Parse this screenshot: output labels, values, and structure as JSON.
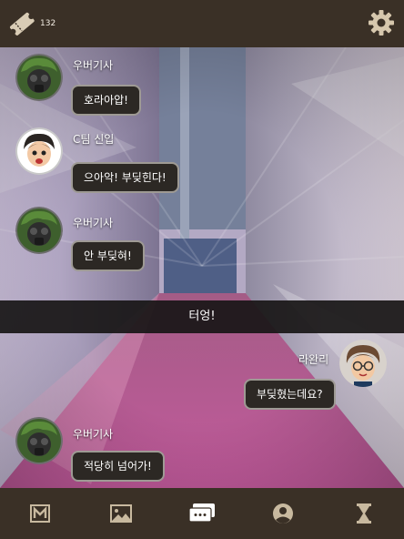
{
  "header": {
    "ticket_count": "132",
    "ticket_icon": "ticket-icon",
    "settings_icon": "gear-icon"
  },
  "chat": {
    "messages": [
      {
        "speaker": "우버기사",
        "text": "호라아압!",
        "side": "left"
      },
      {
        "speaker": "C팀 신입",
        "text": "으아악! 부딪힌다!",
        "side": "left"
      },
      {
        "speaker": "우버기사",
        "text": "안 부딪혀!",
        "side": "left"
      },
      {
        "speaker": "라완리",
        "text": "부딪혔는데요?",
        "side": "right"
      },
      {
        "speaker": "우버기사",
        "text": "적당히 넘어가!",
        "side": "left"
      }
    ],
    "narration": "터엉!"
  },
  "navbar": {
    "items": [
      {
        "icon": "book-icon",
        "active": false
      },
      {
        "icon": "gallery-icon",
        "active": false
      },
      {
        "icon": "chat-icon",
        "active": true
      },
      {
        "icon": "profile-icon",
        "active": false
      },
      {
        "icon": "hourglass-icon",
        "active": false
      }
    ]
  },
  "colors": {
    "bar": "#3a3026",
    "icon": "#c8b99f",
    "bubble": "#2c2824",
    "bubble_border": "#9e9a94"
  }
}
